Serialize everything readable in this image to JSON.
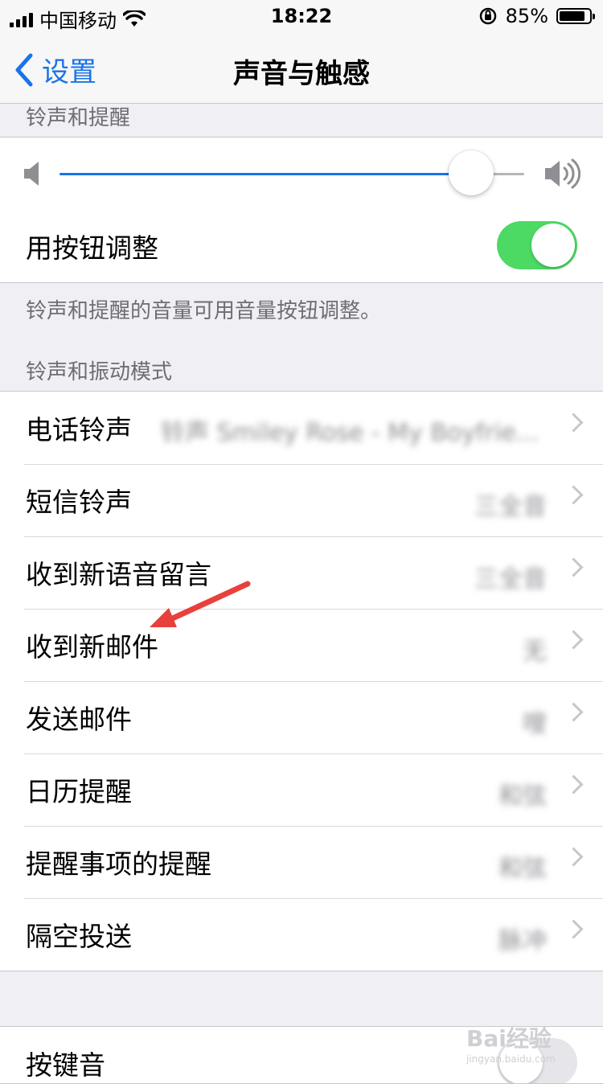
{
  "status": {
    "carrier": "中国移动",
    "time": "18:22",
    "battery": "85%",
    "battery_level": 0.85
  },
  "nav": {
    "back_label": "设置",
    "title": "声音与触感"
  },
  "ringer": {
    "header": "铃声和提醒",
    "volume_level": 0.885,
    "adjust_label": "用按钮调整",
    "adjust_on": true,
    "footer": "铃声和提醒的音量可用音量按钮调整。"
  },
  "patterns": {
    "header": "铃声和振动模式",
    "items": [
      {
        "label": "电话铃声",
        "value": "铃声 Smiley Rose - My Boyfrie..."
      },
      {
        "label": "短信铃声",
        "value": "三全音"
      },
      {
        "label": "收到新语音留言",
        "value": "三全音"
      },
      {
        "label": "收到新邮件",
        "value": "无"
      },
      {
        "label": "发送邮件",
        "value": "嗖"
      },
      {
        "label": "日历提醒",
        "value": "和弦"
      },
      {
        "label": "提醒事项的提醒",
        "value": "和弦"
      },
      {
        "label": "隔空投送",
        "value": "脉冲"
      }
    ]
  },
  "keyboard": {
    "label": "按键音"
  },
  "watermark": {
    "brand": "Bai经验",
    "url": "jingyan.baidu.com"
  },
  "colors": {
    "accent": "#1a73e8",
    "toggle_on": "#4cd964",
    "annotation_arrow": "#e8403c"
  }
}
